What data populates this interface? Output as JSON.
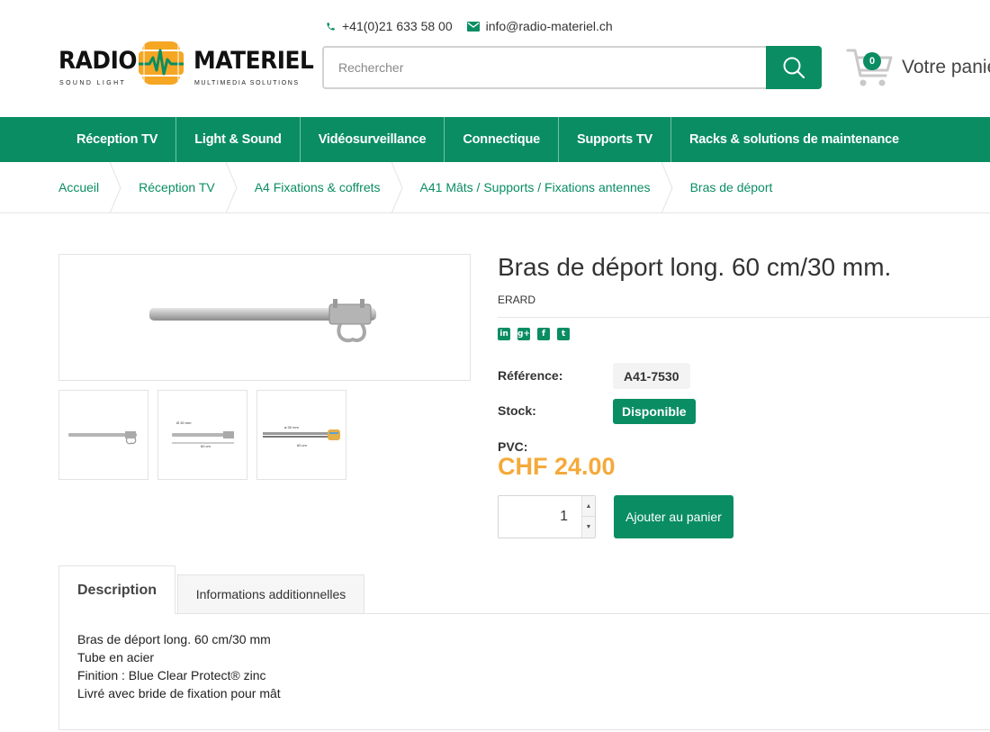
{
  "header": {
    "phone": "+41(0)21 633 58 00",
    "email": "info@radio-materiel.ch",
    "logo": {
      "word_left": "RADIO",
      "word_right": "MATERIEL",
      "sub_left": "SOUND LIGHT",
      "sub_right": "MULTIMEDIA SOLUTIONS"
    },
    "search_placeholder": "Rechercher",
    "cart_count": "0",
    "cart_label": "Votre panier"
  },
  "nav": [
    "Réception TV",
    "Light & Sound",
    "Vidéosurveillance",
    "Connectique",
    "Supports TV",
    "Racks & solutions de maintenance"
  ],
  "breadcrumb": [
    "Accueil",
    "Réception TV",
    "A4 Fixations & coffrets",
    "A41 Mâts / Supports / Fixations antennes",
    "Bras de déport"
  ],
  "product": {
    "title": "Bras de déport long. 60 cm/30 mm.",
    "brand": "ERARD",
    "social": [
      "in",
      "g+",
      "f",
      "t"
    ],
    "reference_label": "Référence:",
    "reference": "A41-7530",
    "stock_label": "Stock:",
    "stock": "Disponible",
    "price_label": "PVC:",
    "price": "CHF 24.00",
    "quantity": "1",
    "add_to_cart": "Ajouter au panier",
    "thumb_labels": {
      "t2_top": "Ø 30 mm",
      "t2_bottom": "60 cm",
      "t3_top": "ø 30 mm",
      "t3_bottom": "60 cm"
    }
  },
  "tabs": {
    "description": "Description",
    "additional": "Informations additionnelles",
    "description_lines": [
      "Bras de déport long. 60 cm/30 mm",
      "Tube en acier",
      "Finition : Blue Clear Protect® zinc",
      "Livré avec bride de fixation pour mât"
    ]
  },
  "colors": {
    "brand_green": "#0a8d63",
    "price_orange": "#f5a93a",
    "logo_yellow": "#f5a623"
  }
}
